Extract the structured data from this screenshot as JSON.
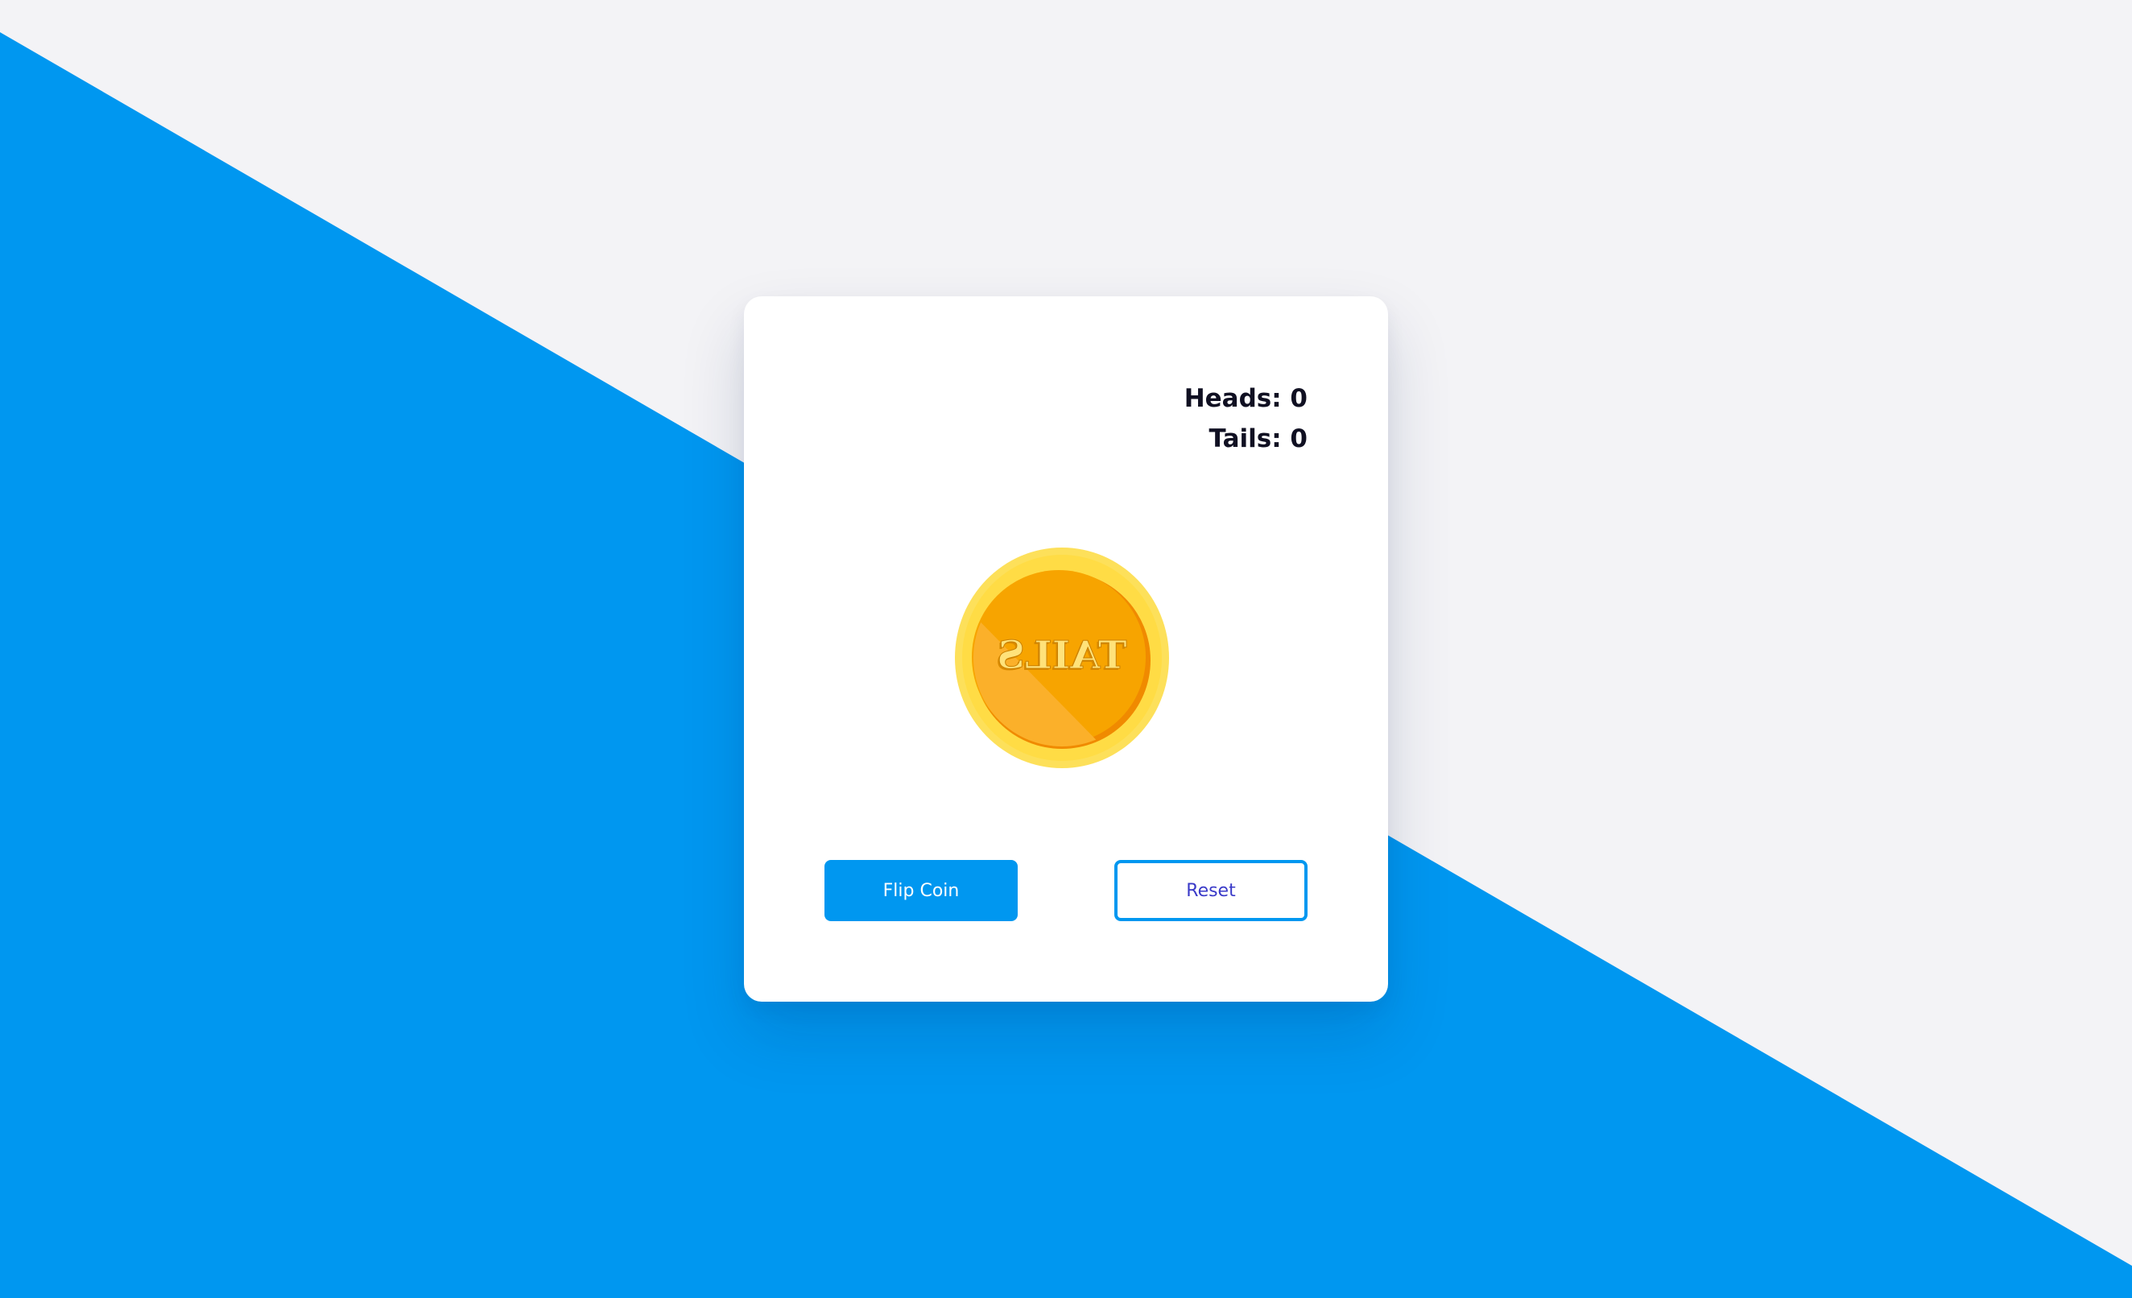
{
  "theme": {
    "accent": "#0097f0",
    "background": "#f3f3f6",
    "card": "#ffffff",
    "score_text": "#101022",
    "reset_text": "#3b3bc8",
    "coin_outer": "#fde05a",
    "coin_inner": "#f7a400"
  },
  "scoreboard": {
    "heads_label": "Heads: 0",
    "tails_label": "Tails: 0"
  },
  "coin": {
    "face": "TAILS",
    "icon": "coin-tails-icon"
  },
  "actions": {
    "flip_label": "Flip Coin",
    "reset_label": "Reset"
  }
}
